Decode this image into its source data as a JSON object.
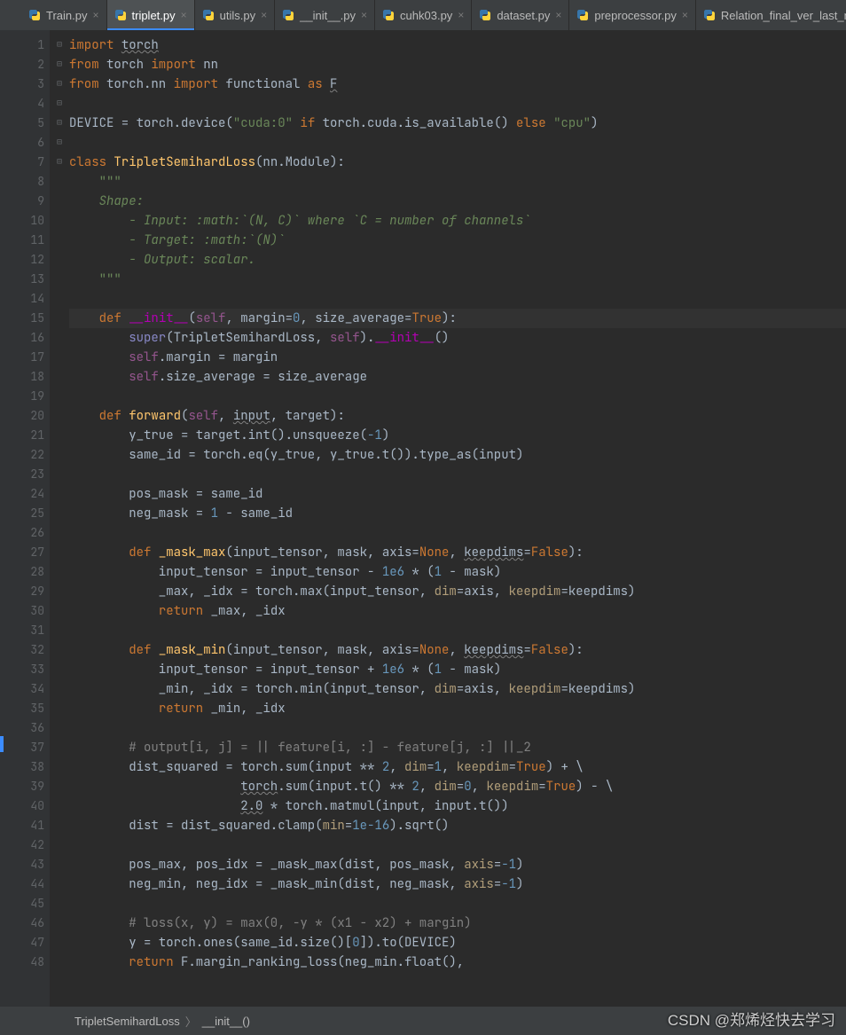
{
  "tabs": [
    {
      "label": "Train.py",
      "active": false
    },
    {
      "label": "triplet.py",
      "active": true
    },
    {
      "label": "utils.py",
      "active": false
    },
    {
      "label": "__init__.py",
      "active": false
    },
    {
      "label": "cuhk03.py",
      "active": false
    },
    {
      "label": "dataset.py",
      "active": false
    },
    {
      "label": "preprocessor.py",
      "active": false
    },
    {
      "label": "Relation_final_ver_last_mul",
      "active": false
    }
  ],
  "gutter": {
    "lines": [
      1,
      2,
      3,
      4,
      5,
      6,
      7,
      8,
      9,
      10,
      11,
      12,
      13,
      14,
      15,
      16,
      17,
      18,
      19,
      20,
      21,
      22,
      23,
      24,
      25,
      26,
      27,
      28,
      29,
      30,
      31,
      32,
      33,
      34,
      35,
      36,
      37,
      38,
      39,
      40,
      41,
      42,
      43,
      44,
      45,
      46,
      47,
      48
    ]
  },
  "highlighted_line_index": 15,
  "code_lines": [
    {
      "t": [
        [
          "kw",
          "import "
        ],
        [
          "warn",
          "torch"
        ]
      ]
    },
    {
      "t": [
        [
          "kw",
          "from "
        ],
        [
          "op",
          "torch "
        ],
        [
          "kw",
          "import "
        ],
        [
          "op",
          "nn"
        ]
      ]
    },
    {
      "t": [
        [
          "kw",
          "from "
        ],
        [
          "op",
          "torch.nn "
        ],
        [
          "kw",
          "import "
        ],
        [
          "op",
          "functional "
        ],
        [
          "kw",
          "as "
        ],
        [
          "warn",
          "F"
        ]
      ]
    },
    {
      "t": [
        [
          "op",
          ""
        ]
      ]
    },
    {
      "t": [
        [
          "op",
          "DEVICE = torch.device("
        ],
        [
          "str",
          "\"cuda:0\""
        ],
        [
          "op",
          " "
        ],
        [
          "kw",
          "if"
        ],
        [
          "op",
          " torch.cuda.is_available() "
        ],
        [
          "kw",
          "else"
        ],
        [
          "op",
          " "
        ],
        [
          "str",
          "\"cpu\""
        ],
        [
          "op",
          ")"
        ]
      ]
    },
    {
      "t": [
        [
          "op",
          ""
        ]
      ]
    },
    {
      "t": [
        [
          "kw",
          "class "
        ],
        [
          "def",
          "TripletSemihardLoss"
        ],
        [
          "op",
          "(nn.Module):"
        ]
      ]
    },
    {
      "t": [
        [
          "op",
          "    "
        ],
        [
          "str",
          "\"\"\""
        ]
      ]
    },
    {
      "t": [
        [
          "op",
          "    "
        ],
        [
          "str-i",
          "Shape:"
        ]
      ]
    },
    {
      "t": [
        [
          "op",
          "        "
        ],
        [
          "str-i",
          "- Input: :math:`(N, C)` where `C = number of channels`"
        ]
      ]
    },
    {
      "t": [
        [
          "op",
          "        "
        ],
        [
          "str-i",
          "- Target: :math:`(N)`"
        ]
      ]
    },
    {
      "t": [
        [
          "op",
          "        "
        ],
        [
          "str-i",
          "- Output: scalar."
        ]
      ]
    },
    {
      "t": [
        [
          "op",
          "    "
        ],
        [
          "str",
          "\"\"\""
        ]
      ]
    },
    {
      "t": [
        [
          "op",
          ""
        ]
      ]
    },
    {
      "t": [
        [
          "op",
          "    "
        ],
        [
          "kw",
          "def "
        ],
        [
          "sp",
          "__init__"
        ],
        [
          "op",
          "("
        ],
        [
          "self",
          "self"
        ],
        [
          "op",
          ", margin="
        ],
        [
          "num",
          "0"
        ],
        [
          "op",
          ", size_average="
        ],
        [
          "kw",
          "True"
        ],
        [
          "op",
          "):"
        ]
      ],
      "hl": true
    },
    {
      "t": [
        [
          "op",
          "        "
        ],
        [
          "builtin",
          "super"
        ],
        [
          "op",
          "(TripletSemihardLoss, "
        ],
        [
          "self",
          "self"
        ],
        [
          "op",
          ")."
        ],
        [
          "sp",
          "__init__"
        ],
        [
          "op",
          "()"
        ]
      ]
    },
    {
      "t": [
        [
          "op",
          "        "
        ],
        [
          "self",
          "self"
        ],
        [
          "op",
          ".margin = margin"
        ]
      ]
    },
    {
      "t": [
        [
          "op",
          "        "
        ],
        [
          "self",
          "self"
        ],
        [
          "op",
          ".size_average = size_average"
        ]
      ]
    },
    {
      "t": [
        [
          "op",
          ""
        ]
      ]
    },
    {
      "t": [
        [
          "op",
          "    "
        ],
        [
          "kw",
          "def "
        ],
        [
          "def",
          "forward"
        ],
        [
          "op",
          "("
        ],
        [
          "self",
          "self"
        ],
        [
          "op",
          ", "
        ],
        [
          "warn",
          "input"
        ],
        [
          "op",
          ", target):"
        ]
      ]
    },
    {
      "t": [
        [
          "op",
          "        y_true = target.int().unsqueeze("
        ],
        [
          "num",
          "-1"
        ],
        [
          "op",
          ")"
        ]
      ]
    },
    {
      "t": [
        [
          "op",
          "        same_id = torch.eq(y_true, y_true.t()).type_as(input)"
        ]
      ]
    },
    {
      "t": [
        [
          "op",
          ""
        ]
      ]
    },
    {
      "t": [
        [
          "op",
          "        pos_mask = same_id"
        ]
      ]
    },
    {
      "t": [
        [
          "op",
          "        neg_mask = "
        ],
        [
          "num",
          "1"
        ],
        [
          "op",
          " - same_id"
        ]
      ]
    },
    {
      "t": [
        [
          "op",
          ""
        ]
      ]
    },
    {
      "t": [
        [
          "op",
          "        "
        ],
        [
          "kw",
          "def "
        ],
        [
          "def",
          "_mask_max"
        ],
        [
          "op",
          "(input_tensor, mask, axis="
        ],
        [
          "kw",
          "None"
        ],
        [
          "op",
          ", "
        ],
        [
          "warn",
          "keepdims"
        ],
        [
          "op",
          "="
        ],
        [
          "kw",
          "False"
        ],
        [
          "op",
          "):"
        ]
      ]
    },
    {
      "t": [
        [
          "op",
          "            input_tensor = input_tensor - "
        ],
        [
          "num",
          "1e6"
        ],
        [
          "op",
          " * ("
        ],
        [
          "num",
          "1"
        ],
        [
          "op",
          " - mask)"
        ]
      ]
    },
    {
      "t": [
        [
          "op",
          "            _max, _idx = torch.max(input_tensor, "
        ],
        [
          "call",
          "dim"
        ],
        [
          "op",
          "=axis, "
        ],
        [
          "call",
          "keepdim"
        ],
        [
          "op",
          "=keepdims)"
        ]
      ]
    },
    {
      "t": [
        [
          "op",
          "            "
        ],
        [
          "kw",
          "return"
        ],
        [
          "op",
          " _max, _idx"
        ]
      ]
    },
    {
      "t": [
        [
          "op",
          ""
        ]
      ]
    },
    {
      "t": [
        [
          "op",
          "        "
        ],
        [
          "kw",
          "def "
        ],
        [
          "def",
          "_mask_min"
        ],
        [
          "op",
          "(input_tensor, mask, axis="
        ],
        [
          "kw",
          "None"
        ],
        [
          "op",
          ", "
        ],
        [
          "warn",
          "keepdims"
        ],
        [
          "op",
          "="
        ],
        [
          "kw",
          "False"
        ],
        [
          "op",
          "):"
        ]
      ]
    },
    {
      "t": [
        [
          "op",
          "            input_tensor = input_tensor + "
        ],
        [
          "num",
          "1e6"
        ],
        [
          "op",
          " * ("
        ],
        [
          "num",
          "1"
        ],
        [
          "op",
          " - mask)"
        ]
      ]
    },
    {
      "t": [
        [
          "op",
          "            _min, _idx = torch.min(input_tensor, "
        ],
        [
          "call",
          "dim"
        ],
        [
          "op",
          "=axis, "
        ],
        [
          "call",
          "keepdim"
        ],
        [
          "op",
          "=keepdims)"
        ]
      ]
    },
    {
      "t": [
        [
          "op",
          "            "
        ],
        [
          "kw",
          "return"
        ],
        [
          "op",
          " _min, _idx"
        ]
      ]
    },
    {
      "t": [
        [
          "op",
          ""
        ]
      ]
    },
    {
      "t": [
        [
          "op",
          "        "
        ],
        [
          "cmt",
          "# output[i, j] = || feature[i, :] - feature[j, :] ||_2"
        ]
      ]
    },
    {
      "t": [
        [
          "op",
          "        dist_squared = torch.sum(input ** "
        ],
        [
          "num",
          "2"
        ],
        [
          "op",
          ", "
        ],
        [
          "call",
          "dim"
        ],
        [
          "op",
          "="
        ],
        [
          "num",
          "1"
        ],
        [
          "op",
          ", "
        ],
        [
          "call",
          "keepdim"
        ],
        [
          "op",
          "="
        ],
        [
          "kw",
          "True"
        ],
        [
          "op",
          ") + \\"
        ]
      ]
    },
    {
      "t": [
        [
          "op",
          "                       "
        ],
        [
          "warn",
          "torch"
        ],
        [
          "op",
          ".sum(input.t() ** "
        ],
        [
          "num",
          "2"
        ],
        [
          "op",
          ", "
        ],
        [
          "call",
          "dim"
        ],
        [
          "op",
          "="
        ],
        [
          "num",
          "0"
        ],
        [
          "op",
          ", "
        ],
        [
          "call",
          "keepdim"
        ],
        [
          "op",
          "="
        ],
        [
          "kw",
          "True"
        ],
        [
          "op",
          ") - \\"
        ]
      ]
    },
    {
      "t": [
        [
          "op",
          "                       "
        ],
        [
          "warn",
          "2.0"
        ],
        [
          "op",
          " * torch.matmul(input, input.t())"
        ]
      ]
    },
    {
      "t": [
        [
          "op",
          "        dist = dist_squared.clamp("
        ],
        [
          "call",
          "min"
        ],
        [
          "op",
          "="
        ],
        [
          "num",
          "1e-16"
        ],
        [
          "op",
          ").sqrt()"
        ]
      ]
    },
    {
      "t": [
        [
          "op",
          ""
        ]
      ]
    },
    {
      "t": [
        [
          "op",
          "        pos_max, pos_idx = _mask_max(dist, pos_mask, "
        ],
        [
          "call",
          "axis"
        ],
        [
          "op",
          "="
        ],
        [
          "num",
          "-1"
        ],
        [
          "op",
          ")"
        ]
      ]
    },
    {
      "t": [
        [
          "op",
          "        neg_min, neg_idx = _mask_min(dist, neg_mask, "
        ],
        [
          "call",
          "axis"
        ],
        [
          "op",
          "="
        ],
        [
          "num",
          "-1"
        ],
        [
          "op",
          ")"
        ]
      ]
    },
    {
      "t": [
        [
          "op",
          ""
        ]
      ]
    },
    {
      "t": [
        [
          "op",
          "        "
        ],
        [
          "cmt",
          "# loss(x, y) = max(0, -y * (x1 - x2) + margin)"
        ]
      ]
    },
    {
      "t": [
        [
          "op",
          "        y = torch.ones(same_id.size()["
        ],
        [
          "num",
          "0"
        ],
        [
          "op",
          "]).to(DEVICE)"
        ]
      ]
    },
    {
      "t": [
        [
          "op",
          "        "
        ],
        [
          "kw",
          "return"
        ],
        [
          "op",
          " F.margin_ranking_loss(neg_min.float(),"
        ]
      ]
    }
  ],
  "breadcrumb": {
    "class": "TripletSemihardLoss",
    "method": "__init__()"
  },
  "watermark": "CSDN @郑烯烃快去学习"
}
